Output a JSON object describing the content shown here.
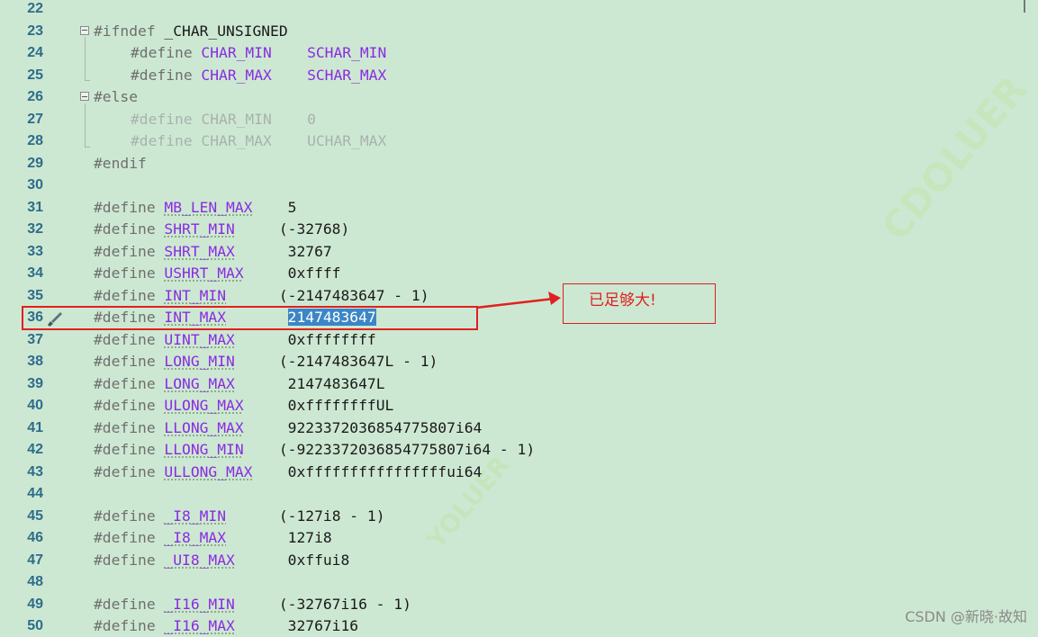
{
  "lines": [
    {
      "num": "22",
      "pp": "",
      "mac": "",
      "val": ""
    },
    {
      "num": "23",
      "pp": "#ifndef ",
      "mac": "",
      "val": "_CHAR_UNSIGNED",
      "indent": 0
    },
    {
      "num": "24",
      "pp": "#define ",
      "mac": "CHAR_MIN",
      "val": "SCHAR_MIN",
      "indent": 1
    },
    {
      "num": "25",
      "pp": "#define ",
      "mac": "CHAR_MAX",
      "val": "SCHAR_MAX",
      "indent": 1
    },
    {
      "num": "26",
      "pp": "#else",
      "mac": "",
      "val": "",
      "indent": 0
    },
    {
      "num": "27",
      "pp": "#define ",
      "mac": "CHAR_MIN",
      "val": "0",
      "indent": 1,
      "grey": true
    },
    {
      "num": "28",
      "pp": "#define ",
      "mac": "CHAR_MAX",
      "val": "UCHAR_MAX",
      "indent": 1,
      "grey": true
    },
    {
      "num": "29",
      "pp": "#endif",
      "mac": "",
      "val": "",
      "indent": 0
    },
    {
      "num": "30",
      "pp": "",
      "mac": "",
      "val": ""
    },
    {
      "num": "31",
      "pp": "#define ",
      "mac": "MB_LEN_MAX",
      "val": "5"
    },
    {
      "num": "32",
      "pp": "#define ",
      "mac": "SHRT_MIN",
      "val": "(-32768)"
    },
    {
      "num": "33",
      "pp": "#define ",
      "mac": "SHRT_MAX",
      "val": "32767"
    },
    {
      "num": "34",
      "pp": "#define ",
      "mac": "USHRT_MAX",
      "val": "0xffff"
    },
    {
      "num": "35",
      "pp": "#define ",
      "mac": "INT_MIN",
      "val": "(-2147483647 - 1)"
    },
    {
      "num": "36",
      "pp": "#define ",
      "mac": "INT_MAX",
      "val": "2147483647"
    },
    {
      "num": "37",
      "pp": "#define ",
      "mac": "UINT_MAX",
      "val": "0xffffffff"
    },
    {
      "num": "38",
      "pp": "#define ",
      "mac": "LONG_MIN",
      "val": "(-2147483647L - 1)"
    },
    {
      "num": "39",
      "pp": "#define ",
      "mac": "LONG_MAX",
      "val": "2147483647L"
    },
    {
      "num": "40",
      "pp": "#define ",
      "mac": "ULONG_MAX",
      "val": "0xffffffffUL"
    },
    {
      "num": "41",
      "pp": "#define ",
      "mac": "LLONG_MAX",
      "val": "9223372036854775807i64"
    },
    {
      "num": "42",
      "pp": "#define ",
      "mac": "LLONG_MIN",
      "val": "(-9223372036854775807i64 - 1)"
    },
    {
      "num": "43",
      "pp": "#define ",
      "mac": "ULLONG_MAX",
      "val": "0xffffffffffffffffui64"
    },
    {
      "num": "44",
      "pp": "",
      "mac": "",
      "val": ""
    },
    {
      "num": "45",
      "pp": "#define ",
      "mac": "_I8_MIN",
      "val": "(-127i8 - 1)"
    },
    {
      "num": "46",
      "pp": "#define ",
      "mac": "_I8_MAX",
      "val": "127i8"
    },
    {
      "num": "47",
      "pp": "#define ",
      "mac": "_UI8_MAX",
      "val": "0xffui8"
    },
    {
      "num": "48",
      "pp": "",
      "mac": "",
      "val": ""
    },
    {
      "num": "49",
      "pp": "#define ",
      "mac": "_I16_MIN",
      "val": "(-32767i16 - 1)"
    },
    {
      "num": "50",
      "pp": "#define ",
      "mac": "_I16_MAX",
      "val": "32767i16"
    }
  ],
  "annotation": {
    "note": "已足够大!"
  },
  "watermark": "CSDN @新晓·故知",
  "bg_watermark_1": "CDOLUER",
  "bg_watermark_2": "YOLUER",
  "colors": {
    "background": "#cde8d2",
    "line_number": "#2e6c8c",
    "macro": "#8a2be2",
    "annotation_red": "#e02020",
    "selection": "#3b86c6"
  }
}
